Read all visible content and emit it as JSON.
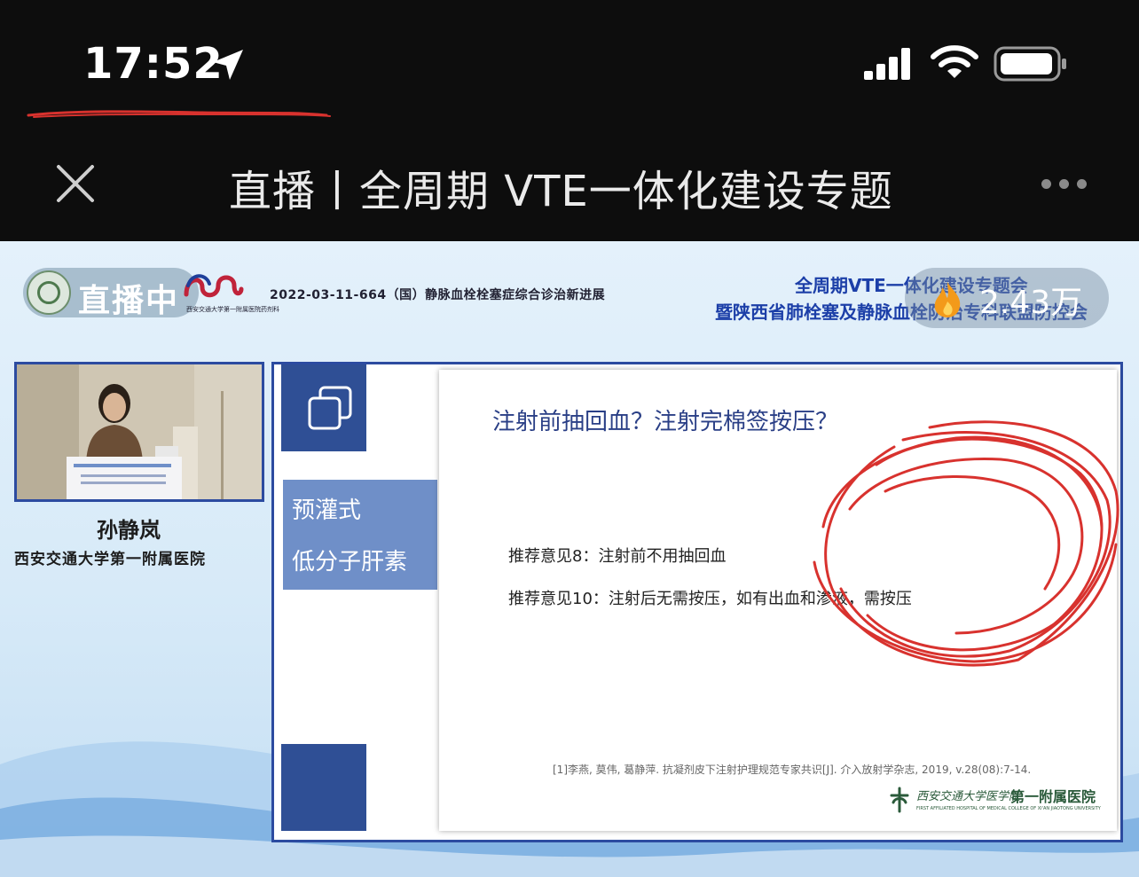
{
  "status_bar": {
    "time": "17:52",
    "icons": [
      "location-arrow-icon",
      "cellular-signal-icon",
      "wifi-icon",
      "battery-icon"
    ]
  },
  "nav": {
    "title": "直播丨全周期 VTE一体化建设专题",
    "close_icon": "close-icon",
    "more_icon": "more-icon"
  },
  "stream": {
    "live_label": "直播中",
    "views": "2.43万",
    "views_icon": "fire-icon",
    "logo_caption": "西安交通大学第一附属医院药剂科",
    "session_date": "2022-03-11-664（国）静脉血栓栓塞症综合诊治新进展",
    "conference_line1": "全周期VTE一体化建设专题会",
    "conference_line2": "暨陕西省肺栓塞及静脉血栓防治专科联盟防控会"
  },
  "speaker": {
    "name": "孙静岚",
    "affiliation": "西安交通大学第一附属医院"
  },
  "slide": {
    "topic_line1": "预灌式",
    "topic_line2": "低分子肝素",
    "heading": "注射前抽回血？注射完棉签按压？",
    "recommendations": [
      "推荐意见8：注射前不用抽回血",
      "推荐意见10：注射后无需按压，如有出血和渗液，需按压"
    ],
    "citation": "[1]李燕, 莫伟, 葛静萍. 抗凝剂皮下注射护理规范专家共识[J]. 介入放射学杂志, 2019, v.28(08):7-14.",
    "hospital_script": "西安交通大学医学院",
    "hospital_name": "第一附属医院",
    "hospital_english": "FIRST AFFILIATED HOSPITAL OF MEDICAL COLLEGE OF XI'AN JIAOTONG UNIVERSITY"
  },
  "colors": {
    "brand_blue": "#2c4ba0",
    "panel_blue": "#6f8fc8",
    "annotation_red": "#d8322e"
  }
}
